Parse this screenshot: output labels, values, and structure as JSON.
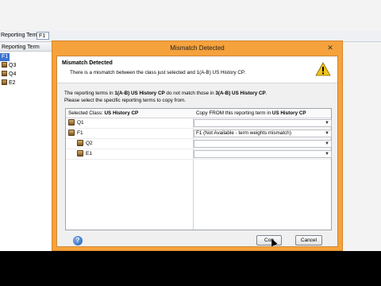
{
  "background": {
    "reporting_term_label": "Reporting Term:",
    "reporting_term_value": "F1",
    "panel_header": "Reporting Term",
    "tree": [
      {
        "label": "F1",
        "selected": true
      },
      {
        "label": "Q3",
        "selected": false
      },
      {
        "label": "Q4",
        "selected": false
      },
      {
        "label": "E2",
        "selected": false
      }
    ]
  },
  "dialog": {
    "title": "Mismatch Detected",
    "close_glyph": "✕",
    "header_title": "Mismatch Detected",
    "header_message": "There is a mismatch between the class just selected and 1(A-B) US History CP.",
    "body_line1_prefix": "The reporting terms in ",
    "body_line1_class1": "1(A-B) US History CP",
    "body_line1_middle": " do not match those in ",
    "body_line1_class2": "3(A-B) US History CP",
    "body_line1_suffix": ".",
    "body_line2": "Please select the specific reporting terms to copy from.",
    "grid": {
      "left_header_prefix": "Selected Class: ",
      "left_header_class": "US History CP",
      "right_header_prefix": "Copy FROM this reporting term in ",
      "right_header_class": "US History CP",
      "rows": [
        {
          "label": "Q1",
          "value": ""
        },
        {
          "label": "F1",
          "value": "F1 (Not Available - term weights mismatch)"
        },
        {
          "label": "Q2",
          "value": ""
        },
        {
          "label": "E1",
          "value": ""
        }
      ]
    },
    "help_glyph": "?",
    "continue_label": "Con",
    "continue_label_obscured": "tinue",
    "cancel_label": "Cancel"
  },
  "colors": {
    "dialog_frame": "#f6a23c",
    "selection": "#3d73d0",
    "help_blue": "#1f5bb0"
  },
  "icons": {
    "warning": "warning-icon",
    "help": "help-icon",
    "close": "close-icon",
    "term_node": "term-node-icon",
    "dropdown": "chevron-down-icon"
  }
}
